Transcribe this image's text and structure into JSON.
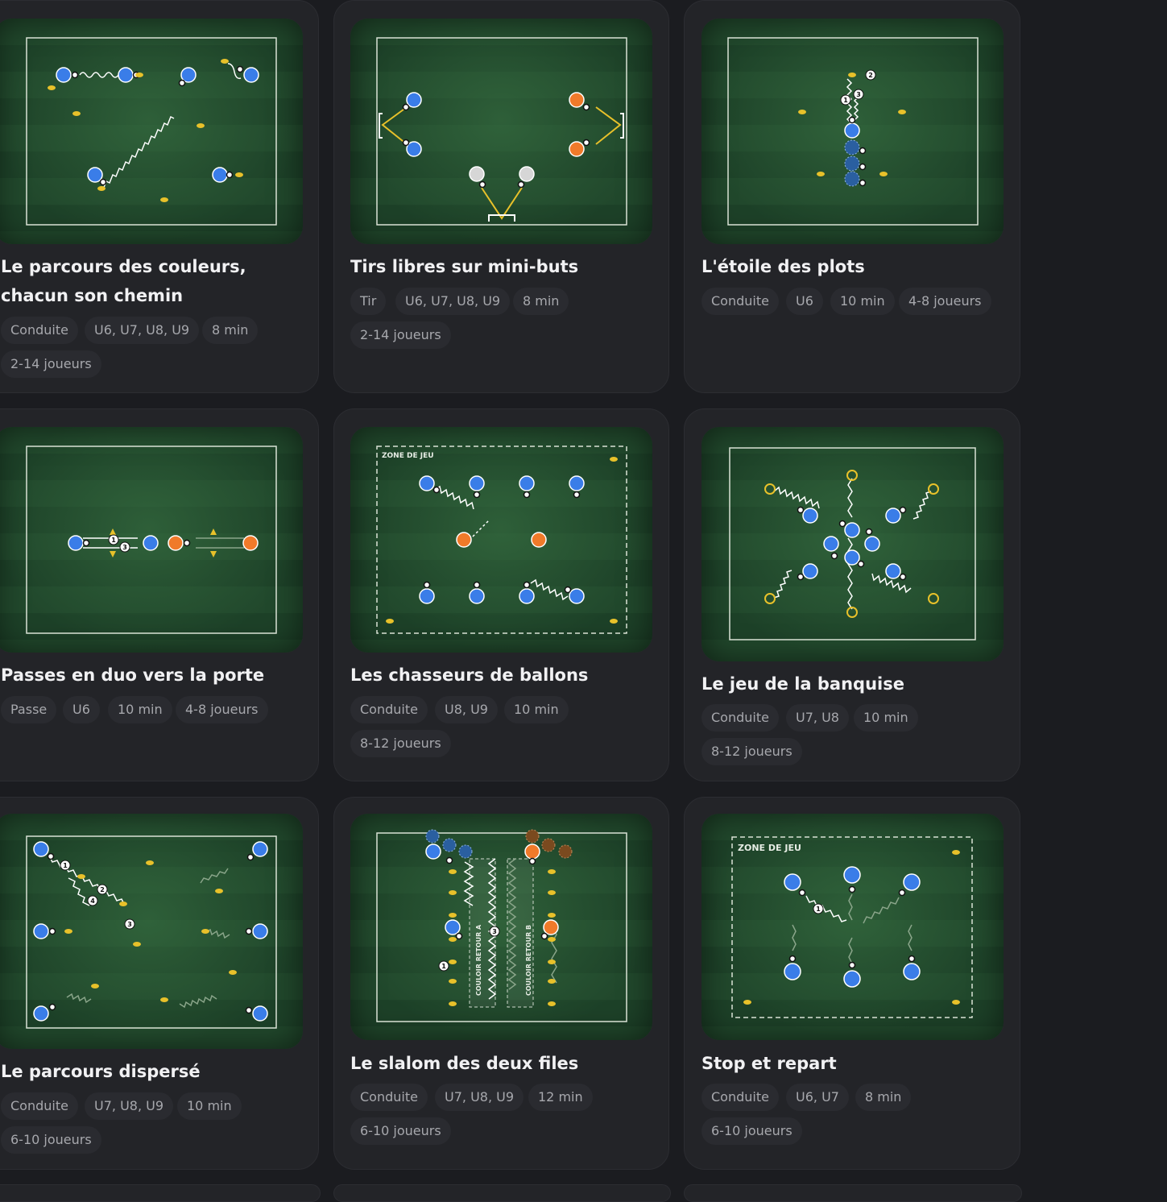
{
  "cards": [
    {
      "title_lines": [
        "Le parcours des couleurs,",
        "chacun son chemin"
      ],
      "tags": [
        "Conduite",
        "U6, U7, U8, U9",
        "8 min",
        "2-14 joueurs"
      ]
    },
    {
      "title_lines": [
        "Tirs libres sur mini-buts"
      ],
      "tags": [
        "Tir",
        "U6, U7, U8, U9",
        "8 min",
        "2-14 joueurs"
      ]
    },
    {
      "title_lines": [
        "L'étoile des plots"
      ],
      "tags": [
        "Conduite",
        "U6",
        "10 min",
        "4-8 joueurs"
      ]
    },
    {
      "title_lines": [
        "Passes en duo vers la porte"
      ],
      "tags": [
        "Passe",
        "U6",
        "10 min",
        "4-8 joueurs"
      ]
    },
    {
      "title_lines": [
        "Les chasseurs de ballons"
      ],
      "tags": [
        "Conduite",
        "U8, U9",
        "10 min",
        "8-12 joueurs"
      ],
      "diagram_label": "ZONE DE JEU"
    },
    {
      "title_lines": [
        "Le jeu de la banquise"
      ],
      "tags": [
        "Conduite",
        "U7, U8",
        "10 min",
        "8-12 joueurs"
      ]
    },
    {
      "title_lines": [
        "Le parcours dispersé"
      ],
      "tags": [
        "Conduite",
        "U7, U8, U9",
        "10 min",
        "6-10 joueurs"
      ]
    },
    {
      "title_lines": [
        "Le slalom des deux files"
      ],
      "tags": [
        "Conduite",
        "U7, U8, U9",
        "12 min",
        "6-10 joueurs"
      ],
      "diagram_labels": [
        "COULOIR RETOUR A",
        "COULOIR RETOUR B"
      ]
    },
    {
      "title_lines": [
        "Stop et repart"
      ],
      "tags": [
        "Conduite",
        "U6, U7",
        "8 min",
        "6-10 joueurs"
      ],
      "diagram_label": "ZONE DE JEU"
    }
  ],
  "colors": {
    "page_bg": "#1b1c20",
    "card_bg": "#232428",
    "player_blue": "#3a7de8",
    "player_orange": "#f07a2a",
    "cone_yellow": "#e8c12a",
    "pitch_green": "#21482c"
  }
}
